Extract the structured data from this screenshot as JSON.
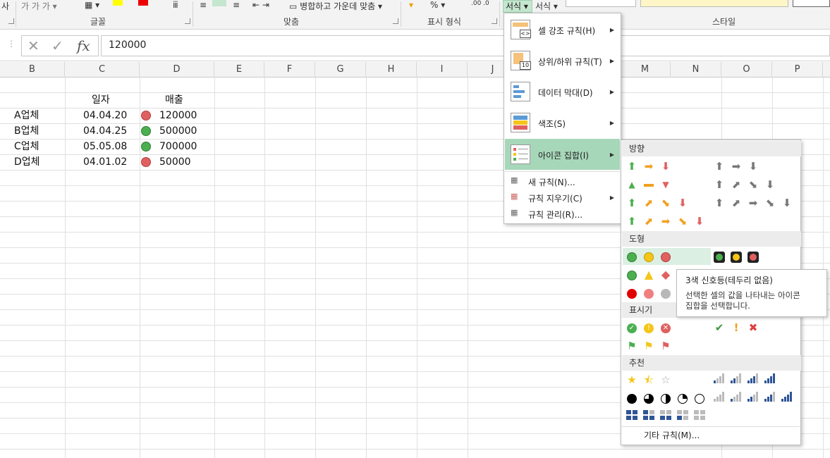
{
  "ribbon": {
    "tab_left": "사",
    "groups": [
      "글꼴",
      "맞춤",
      "표시 형식",
      "스타일"
    ],
    "cf_button": "서식",
    "cf_button2": "서식",
    "merge_label": "병합하고 가운데 맞춤"
  },
  "formula": {
    "value": "120000",
    "fx": "fx"
  },
  "columns": [
    "B",
    "C",
    "D",
    "E",
    "F",
    "G",
    "H",
    "I",
    "J",
    "M",
    "N",
    "O",
    "P"
  ],
  "table": {
    "header_date": "일자",
    "header_sales": "매출",
    "rows": [
      {
        "name": "A업체",
        "date": "04.04.20",
        "sales": "120000",
        "icon": "red"
      },
      {
        "name": "B업체",
        "date": "04.04.25",
        "sales": "500000",
        "icon": "green"
      },
      {
        "name": "C업체",
        "date": "05.05.08",
        "sales": "700000",
        "icon": "green"
      },
      {
        "name": "D업체",
        "date": "04.01.02",
        "sales": "50000",
        "icon": "red"
      }
    ]
  },
  "menu": {
    "items": [
      "셀 강조 규칙(H)",
      "상위/하위 규칙(T)",
      "데이터 막대(D)",
      "색조(S)",
      "아이콘 집합(I)"
    ],
    "small_items": [
      "새 규칙(N)...",
      "규칙 지우기(C)",
      "규칙 관리(R)..."
    ],
    "icon_num": "10",
    "icon_cmp": "<>"
  },
  "submenu": {
    "sections": [
      "방향",
      "도형",
      "표시기",
      "추천"
    ],
    "more": "기타 규칙(M)..."
  },
  "tooltip": {
    "title": "3색 신호등(테두리 없음)",
    "body_line1": "선택한 셀의 값을 나타내는 아이콘",
    "body_line2": "집합을 선택합니다."
  },
  "colors": {
    "green": "#4caf50",
    "yellow": "#f5c518",
    "red": "#e06060",
    "orange": "#f0a020",
    "menu_highlight": "#a7d7b9",
    "grey": "#777777"
  }
}
